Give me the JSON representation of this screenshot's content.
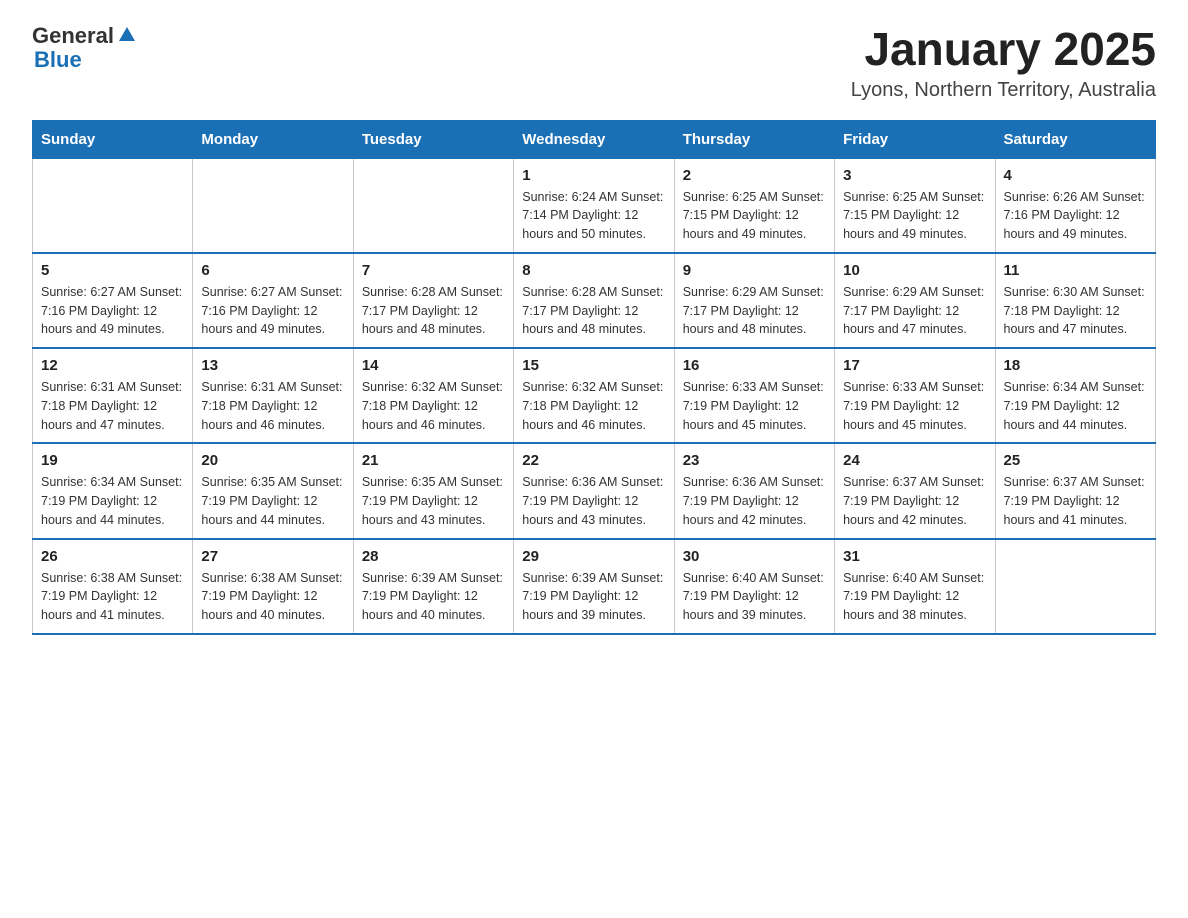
{
  "header": {
    "logo_text_general": "General",
    "logo_text_blue": "Blue",
    "title": "January 2025",
    "subtitle": "Lyons, Northern Territory, Australia"
  },
  "weekdays": [
    "Sunday",
    "Monday",
    "Tuesday",
    "Wednesday",
    "Thursday",
    "Friday",
    "Saturday"
  ],
  "weeks": [
    [
      {
        "day": "",
        "info": ""
      },
      {
        "day": "",
        "info": ""
      },
      {
        "day": "",
        "info": ""
      },
      {
        "day": "1",
        "info": "Sunrise: 6:24 AM\nSunset: 7:14 PM\nDaylight: 12 hours\nand 50 minutes."
      },
      {
        "day": "2",
        "info": "Sunrise: 6:25 AM\nSunset: 7:15 PM\nDaylight: 12 hours\nand 49 minutes."
      },
      {
        "day": "3",
        "info": "Sunrise: 6:25 AM\nSunset: 7:15 PM\nDaylight: 12 hours\nand 49 minutes."
      },
      {
        "day": "4",
        "info": "Sunrise: 6:26 AM\nSunset: 7:16 PM\nDaylight: 12 hours\nand 49 minutes."
      }
    ],
    [
      {
        "day": "5",
        "info": "Sunrise: 6:27 AM\nSunset: 7:16 PM\nDaylight: 12 hours\nand 49 minutes."
      },
      {
        "day": "6",
        "info": "Sunrise: 6:27 AM\nSunset: 7:16 PM\nDaylight: 12 hours\nand 49 minutes."
      },
      {
        "day": "7",
        "info": "Sunrise: 6:28 AM\nSunset: 7:17 PM\nDaylight: 12 hours\nand 48 minutes."
      },
      {
        "day": "8",
        "info": "Sunrise: 6:28 AM\nSunset: 7:17 PM\nDaylight: 12 hours\nand 48 minutes."
      },
      {
        "day": "9",
        "info": "Sunrise: 6:29 AM\nSunset: 7:17 PM\nDaylight: 12 hours\nand 48 minutes."
      },
      {
        "day": "10",
        "info": "Sunrise: 6:29 AM\nSunset: 7:17 PM\nDaylight: 12 hours\nand 47 minutes."
      },
      {
        "day": "11",
        "info": "Sunrise: 6:30 AM\nSunset: 7:18 PM\nDaylight: 12 hours\nand 47 minutes."
      }
    ],
    [
      {
        "day": "12",
        "info": "Sunrise: 6:31 AM\nSunset: 7:18 PM\nDaylight: 12 hours\nand 47 minutes."
      },
      {
        "day": "13",
        "info": "Sunrise: 6:31 AM\nSunset: 7:18 PM\nDaylight: 12 hours\nand 46 minutes."
      },
      {
        "day": "14",
        "info": "Sunrise: 6:32 AM\nSunset: 7:18 PM\nDaylight: 12 hours\nand 46 minutes."
      },
      {
        "day": "15",
        "info": "Sunrise: 6:32 AM\nSunset: 7:18 PM\nDaylight: 12 hours\nand 46 minutes."
      },
      {
        "day": "16",
        "info": "Sunrise: 6:33 AM\nSunset: 7:19 PM\nDaylight: 12 hours\nand 45 minutes."
      },
      {
        "day": "17",
        "info": "Sunrise: 6:33 AM\nSunset: 7:19 PM\nDaylight: 12 hours\nand 45 minutes."
      },
      {
        "day": "18",
        "info": "Sunrise: 6:34 AM\nSunset: 7:19 PM\nDaylight: 12 hours\nand 44 minutes."
      }
    ],
    [
      {
        "day": "19",
        "info": "Sunrise: 6:34 AM\nSunset: 7:19 PM\nDaylight: 12 hours\nand 44 minutes."
      },
      {
        "day": "20",
        "info": "Sunrise: 6:35 AM\nSunset: 7:19 PM\nDaylight: 12 hours\nand 44 minutes."
      },
      {
        "day": "21",
        "info": "Sunrise: 6:35 AM\nSunset: 7:19 PM\nDaylight: 12 hours\nand 43 minutes."
      },
      {
        "day": "22",
        "info": "Sunrise: 6:36 AM\nSunset: 7:19 PM\nDaylight: 12 hours\nand 43 minutes."
      },
      {
        "day": "23",
        "info": "Sunrise: 6:36 AM\nSunset: 7:19 PM\nDaylight: 12 hours\nand 42 minutes."
      },
      {
        "day": "24",
        "info": "Sunrise: 6:37 AM\nSunset: 7:19 PM\nDaylight: 12 hours\nand 42 minutes."
      },
      {
        "day": "25",
        "info": "Sunrise: 6:37 AM\nSunset: 7:19 PM\nDaylight: 12 hours\nand 41 minutes."
      }
    ],
    [
      {
        "day": "26",
        "info": "Sunrise: 6:38 AM\nSunset: 7:19 PM\nDaylight: 12 hours\nand 41 minutes."
      },
      {
        "day": "27",
        "info": "Sunrise: 6:38 AM\nSunset: 7:19 PM\nDaylight: 12 hours\nand 40 minutes."
      },
      {
        "day": "28",
        "info": "Sunrise: 6:39 AM\nSunset: 7:19 PM\nDaylight: 12 hours\nand 40 minutes."
      },
      {
        "day": "29",
        "info": "Sunrise: 6:39 AM\nSunset: 7:19 PM\nDaylight: 12 hours\nand 39 minutes."
      },
      {
        "day": "30",
        "info": "Sunrise: 6:40 AM\nSunset: 7:19 PM\nDaylight: 12 hours\nand 39 minutes."
      },
      {
        "day": "31",
        "info": "Sunrise: 6:40 AM\nSunset: 7:19 PM\nDaylight: 12 hours\nand 38 minutes."
      },
      {
        "day": "",
        "info": ""
      }
    ]
  ]
}
